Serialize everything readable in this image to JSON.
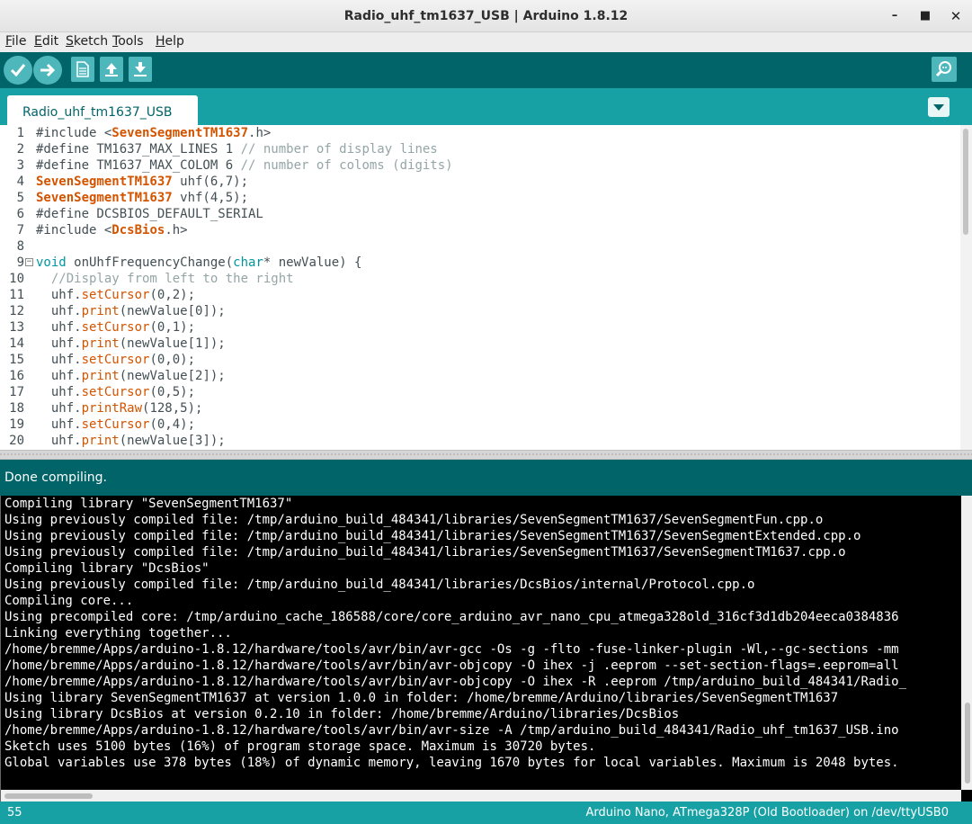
{
  "window": {
    "title": "Radio_uhf_tm1637_USB | Arduino 1.8.12",
    "controls": {
      "minimize": "–",
      "maximize": "■",
      "close": "✕"
    }
  },
  "menu": [
    "File",
    "Edit",
    "Sketch",
    "Tools",
    "Help"
  ],
  "toolbar": {
    "buttons": [
      "verify-icon",
      "upload-icon",
      "new-sketch-icon",
      "open-icon",
      "save-icon",
      "serial-monitor-icon"
    ],
    "accent": "#006468",
    "button_color": "#4db7bb"
  },
  "tabs": [
    {
      "label": "Radio_uhf_tm1637_USB",
      "active": true
    }
  ],
  "editor": {
    "lines": [
      [
        {
          "t": "#include <"
        },
        {
          "t": "SevenSegmentTM1637",
          "c": "cls"
        },
        {
          "t": ".h>"
        }
      ],
      [
        {
          "t": "#define TM1637_MAX_LINES 1 "
        },
        {
          "t": "// number of display lines",
          "c": "cmt"
        }
      ],
      [
        {
          "t": "#define TM1637_MAX_COLOM 6 "
        },
        {
          "t": "// number of coloms (digits)",
          "c": "cmt"
        }
      ],
      [
        {
          "t": "SevenSegmentTM1637",
          "c": "cls"
        },
        {
          "t": " uhf(6,7);"
        }
      ],
      [
        {
          "t": "SevenSegmentTM1637",
          "c": "cls"
        },
        {
          "t": " vhf(4,5);"
        }
      ],
      [
        {
          "t": "#define DCSBIOS_DEFAULT_SERIAL"
        }
      ],
      [
        {
          "t": "#include <"
        },
        {
          "t": "DcsBios",
          "c": "cls"
        },
        {
          "t": ".h>"
        }
      ],
      [
        {
          "t": ""
        }
      ],
      [
        {
          "t": "void",
          "c": "kw"
        },
        {
          "t": " onUhfFrequencyChange("
        },
        {
          "t": "char",
          "c": "kw"
        },
        {
          "t": "* newValue) {"
        }
      ],
      [
        {
          "t": "  "
        },
        {
          "t": "//Display from left to the right",
          "c": "cmt"
        }
      ],
      [
        {
          "t": "  uhf."
        },
        {
          "t": "setCursor",
          "c": "fn"
        },
        {
          "t": "(0,2);"
        }
      ],
      [
        {
          "t": "  uhf."
        },
        {
          "t": "print",
          "c": "fn"
        },
        {
          "t": "(newValue[0]);"
        }
      ],
      [
        {
          "t": "  uhf."
        },
        {
          "t": "setCursor",
          "c": "fn"
        },
        {
          "t": "(0,1);"
        }
      ],
      [
        {
          "t": "  uhf."
        },
        {
          "t": "print",
          "c": "fn"
        },
        {
          "t": "(newValue[1]);"
        }
      ],
      [
        {
          "t": "  uhf."
        },
        {
          "t": "setCursor",
          "c": "fn"
        },
        {
          "t": "(0,0);"
        }
      ],
      [
        {
          "t": "  uhf."
        },
        {
          "t": "print",
          "c": "fn"
        },
        {
          "t": "(newValue[2]);"
        }
      ],
      [
        {
          "t": "  uhf."
        },
        {
          "t": "setCursor",
          "c": "fn"
        },
        {
          "t": "(0,5);"
        }
      ],
      [
        {
          "t": "  uhf."
        },
        {
          "t": "printRaw",
          "c": "fn"
        },
        {
          "t": "(128,5);"
        }
      ],
      [
        {
          "t": "  uhf."
        },
        {
          "t": "setCursor",
          "c": "fn"
        },
        {
          "t": "(0,4);"
        }
      ],
      [
        {
          "t": "  uhf."
        },
        {
          "t": "print",
          "c": "fn"
        },
        {
          "t": "(newValue[3]);"
        }
      ]
    ],
    "fold_line": 9
  },
  "status": {
    "message": "Done compiling."
  },
  "console": {
    "lines": [
      "Compiling library \"SevenSegmentTM1637\"",
      "Using previously compiled file: /tmp/arduino_build_484341/libraries/SevenSegmentTM1637/SevenSegmentFun.cpp.o",
      "Using previously compiled file: /tmp/arduino_build_484341/libraries/SevenSegmentTM1637/SevenSegmentExtended.cpp.o",
      "Using previously compiled file: /tmp/arduino_build_484341/libraries/SevenSegmentTM1637/SevenSegmentTM1637.cpp.o",
      "Compiling library \"DcsBios\"",
      "Using previously compiled file: /tmp/arduino_build_484341/libraries/DcsBios/internal/Protocol.cpp.o",
      "Compiling core...",
      "Using precompiled core: /tmp/arduino_cache_186588/core/core_arduino_avr_nano_cpu_atmega328old_316cf3d1db204eeca0384836",
      "Linking everything together...",
      "/home/bremme/Apps/arduino-1.8.12/hardware/tools/avr/bin/avr-gcc -Os -g -flto -fuse-linker-plugin -Wl,--gc-sections -mm",
      "/home/bremme/Apps/arduino-1.8.12/hardware/tools/avr/bin/avr-objcopy -O ihex -j .eeprom --set-section-flags=.eeprom=all",
      "/home/bremme/Apps/arduino-1.8.12/hardware/tools/avr/bin/avr-objcopy -O ihex -R .eeprom /tmp/arduino_build_484341/Radio_",
      "Using library SevenSegmentTM1637 at version 1.0.0 in folder: /home/bremme/Arduino/libraries/SevenSegmentTM1637",
      "Using library DcsBios at version 0.2.10 in folder: /home/bremme/Arduino/libraries/DcsBios",
      "/home/bremme/Apps/arduino-1.8.12/hardware/tools/avr/bin/avr-size -A /tmp/arduino_build_484341/Radio_uhf_tm1637_USB.ino",
      "Sketch uses 5100 bytes (16%) of program storage space. Maximum is 30720 bytes.",
      "Global variables use 378 bytes (18%) of dynamic memory, leaving 1670 bytes for local variables. Maximum is 2048 bytes."
    ]
  },
  "footer": {
    "line_number": "55",
    "board": "Arduino Nano, ATmega328P (Old Bootloader) on /dev/ttyUSB0"
  }
}
